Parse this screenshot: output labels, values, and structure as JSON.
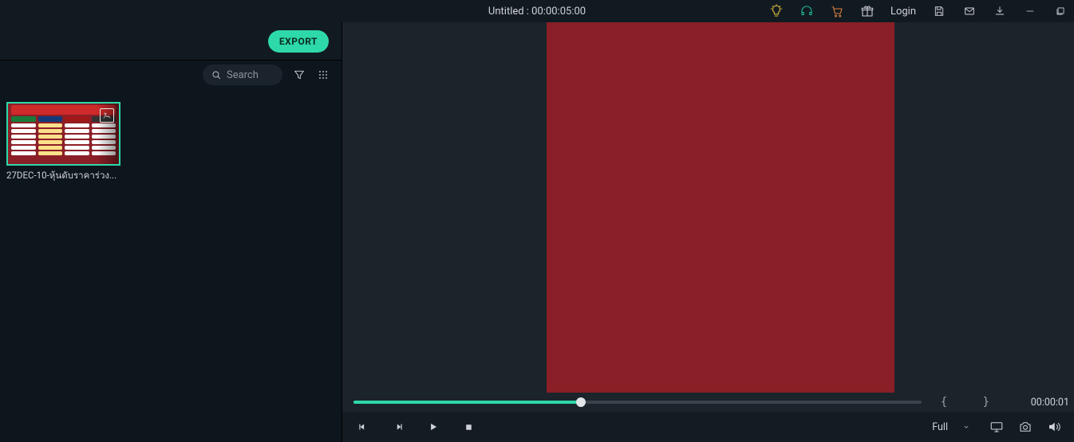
{
  "header": {
    "title": "Untitled : 00:00:05:00",
    "login_label": "Login"
  },
  "left_panel": {
    "export_label": "EXPORT",
    "search_placeholder": "Search"
  },
  "media": {
    "items": [
      {
        "filename": "27DEC-10-หุ้นดับราคาร่วง..."
      }
    ]
  },
  "preview": {
    "timecode_end": "00:00:01",
    "markers_glyph": "{    }",
    "quality_label": "Full",
    "progress_pct": 40
  }
}
